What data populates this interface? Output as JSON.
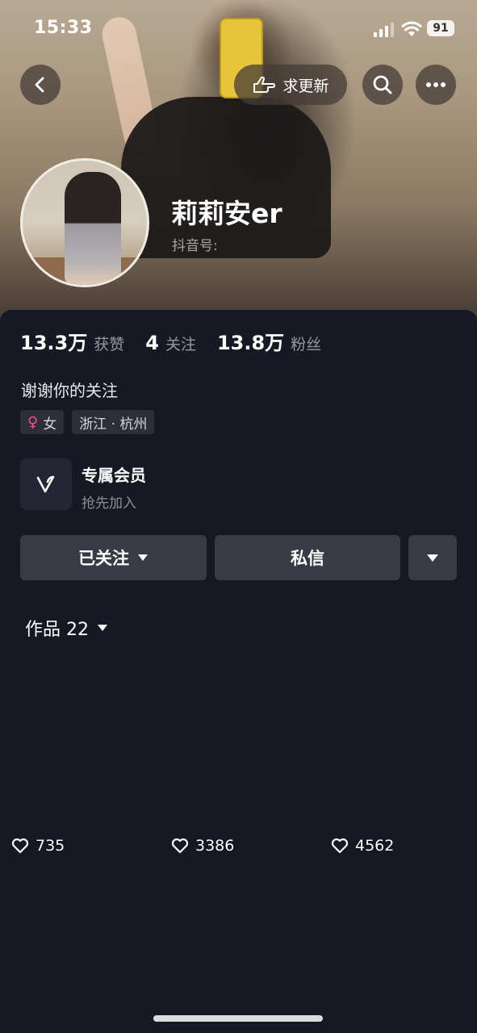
{
  "status_bar": {
    "time": "15:33",
    "battery": "91"
  },
  "header": {
    "request_update_label": "求更新",
    "username": "莉莉安er",
    "douyin_id_label": "抖音号:"
  },
  "stats": [
    {
      "value": "13.3万",
      "label": "获赞"
    },
    {
      "value": "4",
      "label": "关注"
    },
    {
      "value": "13.8万",
      "label": "粉丝"
    }
  ],
  "bio": "谢谢你的关注",
  "tags": {
    "gender": "女",
    "location": "浙江 · 杭州"
  },
  "membership": {
    "title": "专属会员",
    "subtitle": "抢先加入"
  },
  "actions": {
    "followed": "已关注",
    "message": "私信"
  },
  "works_tab": {
    "label": "作品 22"
  },
  "videos": [
    {
      "likes": "735",
      "palette": [
        "#2a2a44",
        "#c8a8b8"
      ]
    },
    {
      "likes": "3386",
      "palette": [
        "#e6e0d6",
        "#c8142a"
      ]
    },
    {
      "likes": "4562",
      "palette": [
        "#a89884",
        "#e8e2d6"
      ]
    },
    {
      "likes": "",
      "palette": [
        "#d8d0c2",
        "#1a1a1c"
      ]
    },
    {
      "likes": "",
      "palette": [
        "#5f6a5c",
        "#e8a8a0"
      ]
    },
    {
      "likes": "",
      "palette": [
        "#8a7c6c",
        "#141414"
      ]
    }
  ]
}
